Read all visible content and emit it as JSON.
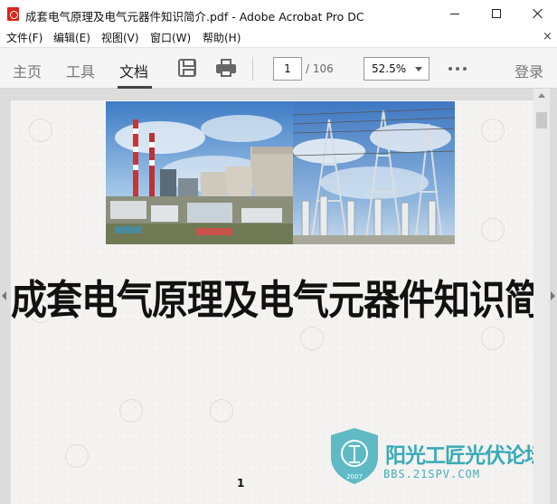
{
  "window": {
    "title": "成套电气原理及电气元器件知识简介.pdf - Adobe Acrobat Pro DC",
    "controls": [
      "minimize-icon",
      "maximize-icon",
      "close-icon"
    ]
  },
  "menu": {
    "items": [
      {
        "label": "文件(F)"
      },
      {
        "label": "编辑(E)"
      },
      {
        "label": "视图(V)"
      },
      {
        "label": "窗口(W)"
      },
      {
        "label": "帮助(H)"
      }
    ],
    "close_glyph": "×"
  },
  "toolbar": {
    "tabs": [
      {
        "label": "主页"
      },
      {
        "label": "工具"
      },
      {
        "label": "文档",
        "active": true
      }
    ],
    "icons": [
      "save-icon",
      "print-icon",
      "more-icon"
    ],
    "page_current": "1",
    "page_total": "/ 106",
    "zoom": "52.5%",
    "login": "登录"
  },
  "document": {
    "title": "成套电气原理及电气元器件知识简介",
    "page_number": "1",
    "images": [
      "power-plant-photo",
      "substation-photo"
    ],
    "watermark": {
      "site_name": "阳光工匠光伏论坛",
      "url": "BBS.21SPV.COM",
      "logo_year": "2007"
    }
  },
  "colors": {
    "pdf_icon": "#d8271c",
    "watermark": "#2fa7b5",
    "page_background": "#f4f3f1",
    "viewer_background": "#dcdcdc"
  }
}
